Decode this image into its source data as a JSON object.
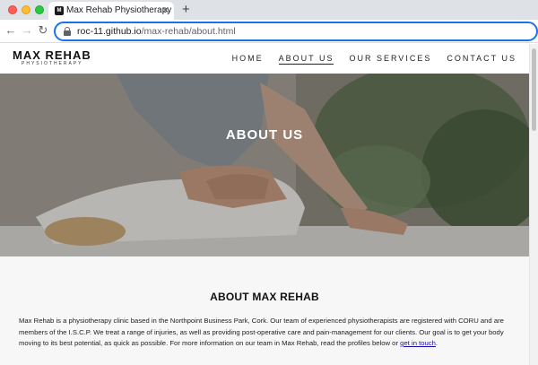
{
  "browser": {
    "tab_title": "Max Rehab Physiotherapy",
    "tab_favicon": "M",
    "tab_close_icon": "close-icon",
    "new_tab_label": "+",
    "back_label": "←",
    "forward_label": "→",
    "reload_label": "↻",
    "url_host": "roc-11.github.io",
    "url_path": "/max-rehab/about.html"
  },
  "site": {
    "logo_main": "MAX REHAB",
    "logo_sub": "PHYSIOTHERAPY",
    "nav": [
      {
        "label": "HOME"
      },
      {
        "label": "ABOUT US",
        "active": true
      },
      {
        "label": "OUR SERVICES"
      },
      {
        "label": "CONTACT US"
      }
    ]
  },
  "hero": {
    "title": "ABOUT US"
  },
  "about": {
    "title": "ABOUT MAX REHAB",
    "body": "Max Rehab is a physiotherapy clinic based in the Northpoint Business Park, Cork. Our team of experienced physiotherapists are registered with CORU and are members of the I.S.C.P. We treat a range of injuries, as well as providing post-operative care and pain-management for our clients. Our goal is to get your body moving to its best potential, as quick as possible. For more information on our team in Max Rehab, read the profiles below or ",
    "link_text": "get in touch",
    "body_end": "."
  },
  "colors": {
    "accent": "#1a73e8",
    "link": "#1a0dab",
    "section_bg": "#f7f7f7"
  }
}
